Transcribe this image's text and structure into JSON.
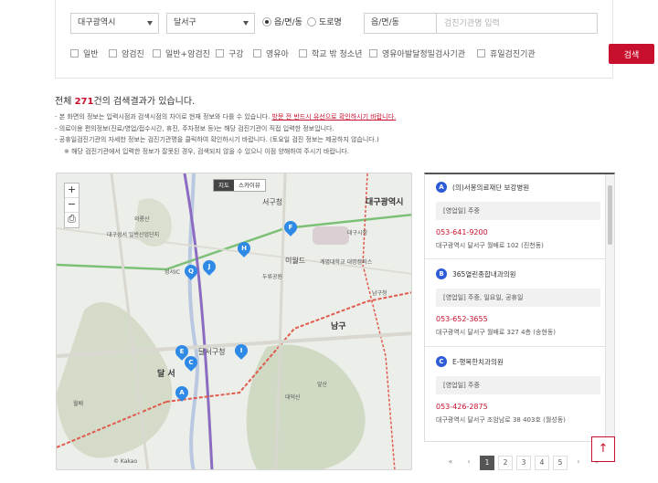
{
  "search": {
    "city": "대구광역시",
    "district": "달서구",
    "radio_1": "읍/면/동",
    "radio_2": "도로명",
    "dong": "읍/면/동",
    "keyword_placeholder": "검진기관명 입력",
    "checkboxes": [
      "일반",
      "암검진",
      "일반+암검진",
      "구강",
      "영유아",
      "학교 밖 청소년",
      "영유아발달정밀검사기관",
      "휴일검진기관"
    ],
    "button": "검색"
  },
  "result": {
    "prefix": "전체 ",
    "count": "271",
    "suffix": "건의 검색결과가 있습니다."
  },
  "notices": {
    "line1_a": "- 본 화면의 정보는 입력시점과 검색시점의 차이로 현재 정보와 다를 수 있습니다.",
    "line1_b": "방문 전 반드시 유선으로 확인하시기 바랍니다.",
    "line2": "- 의료이용 편의정보(진료/영업/접수시간, 휴진, 주차정보 등)는 해당 검진기관이 직접 입력한 정보입니다.",
    "line3": "- 공휴일검진기관의 자세한 정보는 검진기관명을 클릭하여 확인하시기 바랍니다. (토요일 검진 정보는 제공하지 않습니다.)",
    "line4": "※ 해당 검진기관에서 입력한 정보가 잘못된 경우, 검색되지 않을 수 있으니 이점 양해하여 주시기 바랍니다."
  },
  "map": {
    "type_map": "지도",
    "type_sky": "스카이뷰",
    "zoom_in": "+",
    "zoom_out": "−",
    "print": "⎙",
    "copyright": "© Kakao",
    "labels": {
      "daegu": "대구광역시",
      "seogu": "서구청",
      "dalseo": "달서구",
      "dalseo_office": "달서구청",
      "nam": "남구",
      "isidong": "이월드",
      "duryu": "두류공원",
      "keimyung": "계명대학교 대명캠퍼스",
      "waryong": "와룡산",
      "daegu_seongseo": "대구성서 일반산업단지",
      "daegu_gov": "대구시청",
      "nam_office": "남구청",
      "apsan": "앞산",
      "daedeok": "대덕산",
      "seongseo": "성서IC",
      "wolbae": "월배",
      "dalseo_gu": "달 서"
    },
    "pins": [
      "A",
      "B",
      "C",
      "E",
      "F",
      "H",
      "I",
      "J",
      "Q"
    ]
  },
  "facilities": [
    {
      "badge": "A",
      "name": "(의)서봉의료재단 보강병원",
      "hours": "[영업일] 주중",
      "phone": "053-641-9200",
      "address": "대구광역시 달서구 월배로 102 (진천동)"
    },
    {
      "badge": "B",
      "name": "365열린종합내과의원",
      "hours": "[영업일] 주중, 일요일, 공휴일",
      "phone": "053-652-3655",
      "address": "대구광역시 달서구 월배로 327 4층 (송현동)"
    },
    {
      "badge": "C",
      "name": "E-행복한치과의원",
      "hours": "[영업일] 주중",
      "phone": "053-426-2875",
      "address": "대구광역시 달서구 조암남로 38 403호 (월성동)"
    }
  ],
  "pagination": {
    "first": "«",
    "prev": "‹",
    "pages": [
      "1",
      "2",
      "3",
      "4",
      "5"
    ],
    "current": "1",
    "next": "›",
    "last": "»"
  },
  "top_button": "↑",
  "colors": {
    "accent": "#c8102e",
    "pin": "#2e8ae6",
    "badge": "#2e5bd6"
  }
}
